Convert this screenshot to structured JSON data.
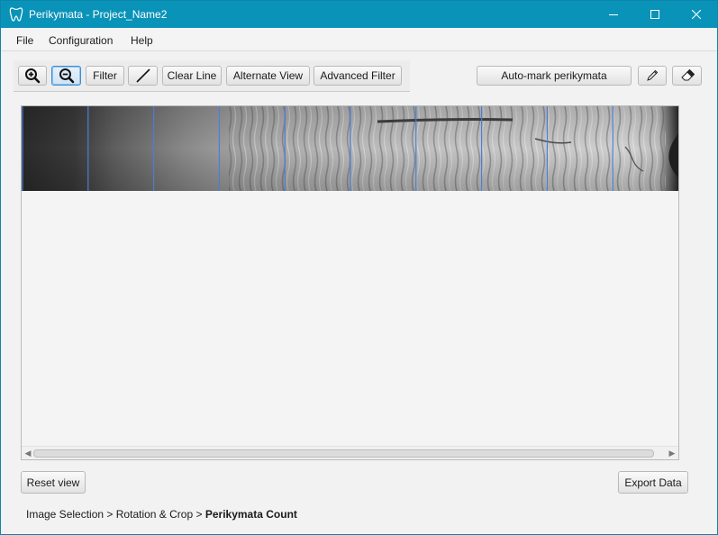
{
  "window": {
    "title": "Perikymata - Project_Name2",
    "app_icon": "tooth-icon",
    "controls": [
      "minimize-icon",
      "maximize-icon",
      "close-icon"
    ]
  },
  "menu": {
    "items": [
      "File",
      "Configuration",
      "Help"
    ]
  },
  "toolbar": {
    "zoom_in_icon": "zoom-in-icon",
    "zoom_out_icon": "zoom-out-icon",
    "zoom_out_pressed": true,
    "filter_label": "Filter",
    "draw_line_icon": "line-icon",
    "clear_line_label": "Clear Line",
    "alternate_view_label": "Alternate View",
    "advanced_filter_label": "Advanced Filter",
    "auto_mark_label": "Auto-mark perikymata",
    "pencil_icon": "pencil-icon",
    "eraser_icon": "eraser-icon"
  },
  "viewer": {
    "image_description": "tooth-surface-micrograph",
    "marker_line_color": "#4a7fd6",
    "marker_count": 10
  },
  "footer": {
    "reset_view_label": "Reset view",
    "export_data_label": "Export Data"
  },
  "breadcrumb": {
    "step1": "Image Selection",
    "sep1": ">",
    "step2": "Rotation & Crop",
    "sep2": ">",
    "step3": "Perikymata Count"
  },
  "colors": {
    "titlebar": "#0a93b8",
    "pressed_border": "#3a8fd9"
  }
}
